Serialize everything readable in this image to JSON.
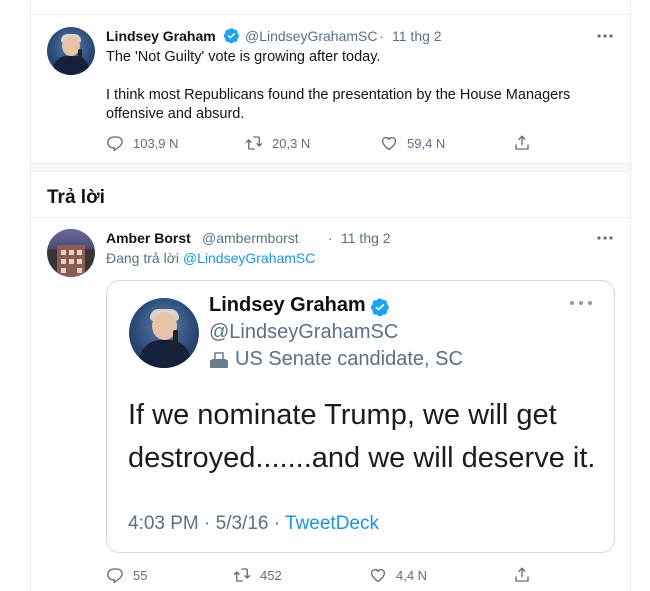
{
  "tweet": {
    "author_name": "Lindsey Graham",
    "handle": "@LindseyGrahamSC",
    "separator": "·",
    "date": "11 thg 2",
    "line1": "The 'Not Guilty' vote is growing after today.",
    "line2": "I think most Republicans found the presentation by the House Managers offensive and absurd.",
    "reply_count": "103,9 N",
    "retweet_count": "20,3 N",
    "like_count": "59,4 N"
  },
  "replies_header": "Trả lời",
  "reply": {
    "author_name": "Amber Borst",
    "handle": "@ambermborst",
    "separator": "·",
    "date": "11 thg 2",
    "replying_prefix": "Đang trả lời",
    "replying_handle": "@LindseyGrahamSC",
    "reply_count": "55",
    "retweet_count": "452",
    "like_count": "4,4 N",
    "embedded_screenshot": {
      "name": "Lindsey Graham",
      "handle": "@LindseyGrahamSC",
      "bio_label": "US Senate candidate, SC",
      "text": "If we nominate Trump, we will get destroyed.......and we will deserve it.",
      "timestamp": "4:03 PM · 5/3/16 · ",
      "source": "TweetDeck"
    }
  },
  "colors": {
    "accent": "#1b95e0",
    "secondary_text": "#5b7083",
    "verified": "#1da1f2"
  },
  "icons": [
    "verified-badge-icon",
    "more-icon",
    "reply-icon",
    "retweet-icon",
    "like-icon",
    "share-icon",
    "ballot-box-icon"
  ]
}
